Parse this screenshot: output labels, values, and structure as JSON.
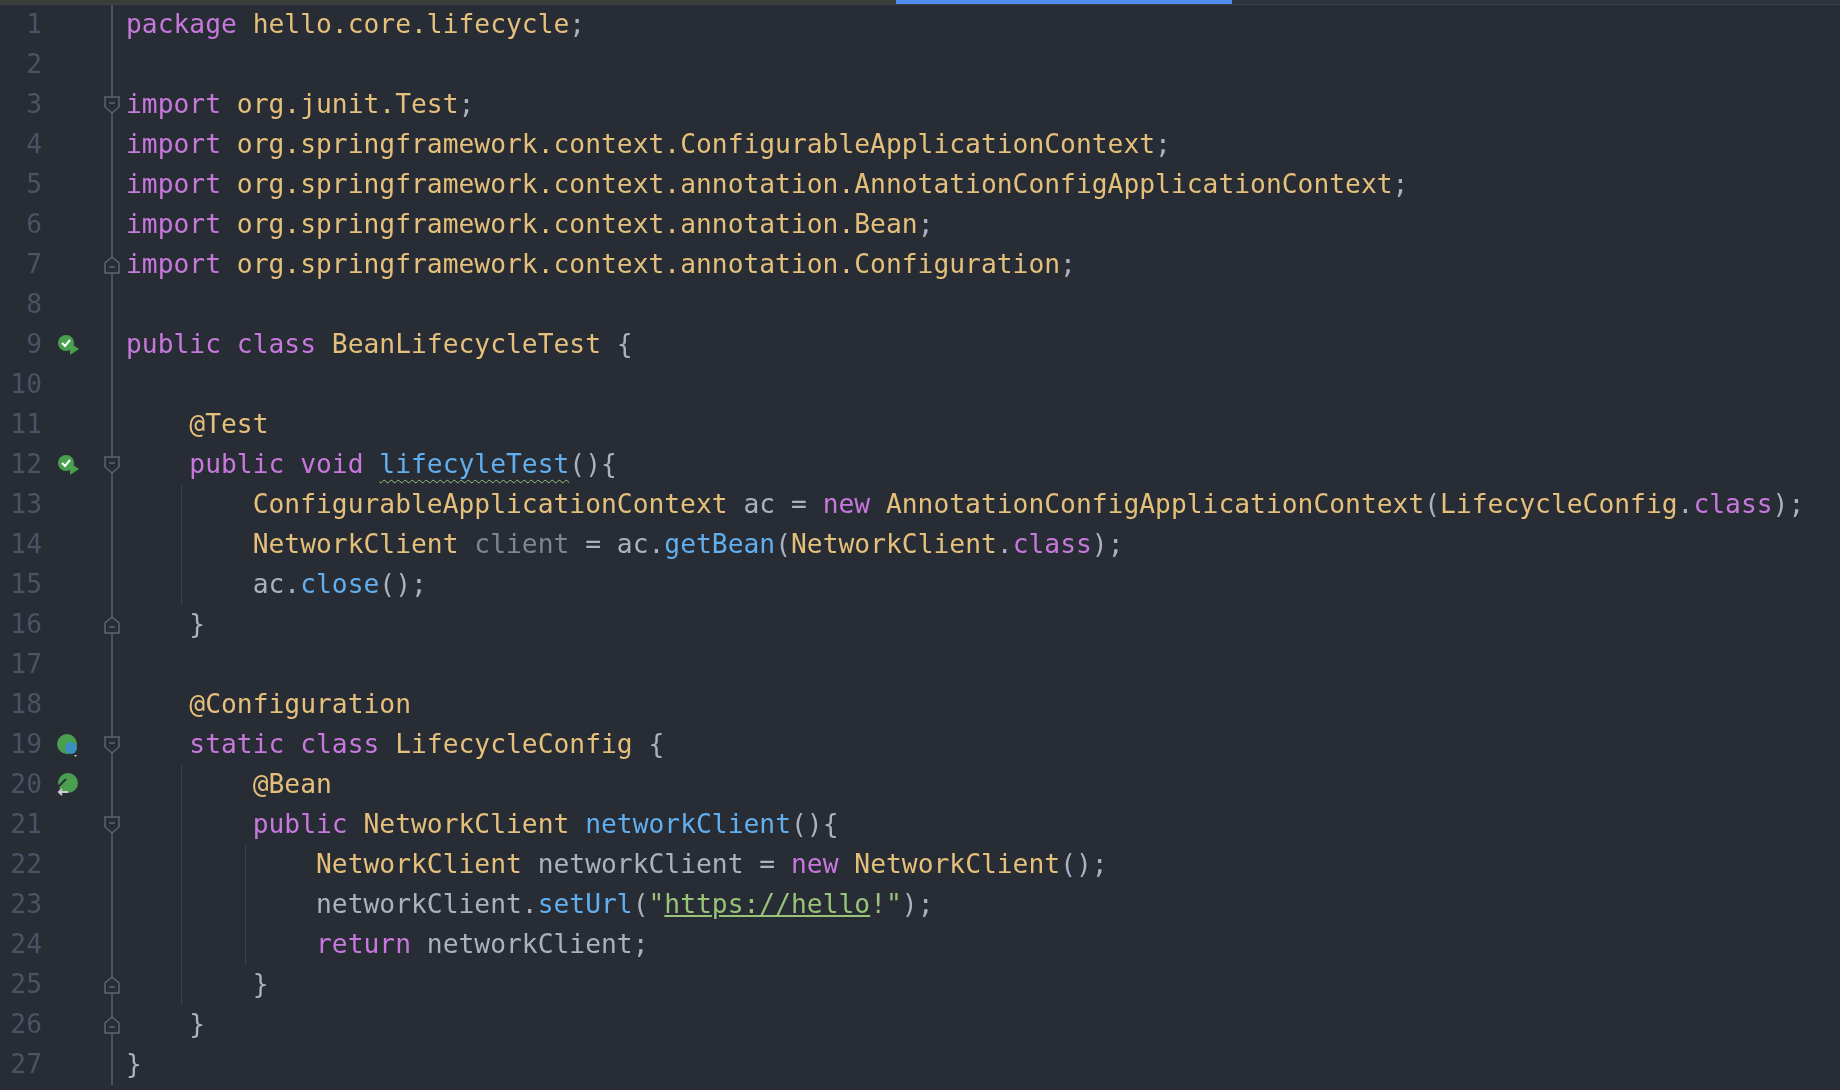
{
  "editor": {
    "lines": [
      {
        "number": "1",
        "kind": "code",
        "tokens": [
          {
            "text": "package",
            "kind": "keyword"
          },
          {
            "text": " hello.core.lifecycle",
            "kind": "type"
          },
          {
            "text": ";",
            "kind": "plain"
          }
        ]
      },
      {
        "number": "2",
        "kind": "code"
      },
      {
        "number": "3",
        "kind": "code",
        "collapsible": true,
        "tokens": [
          {
            "text": "import",
            "kind": "keyword"
          },
          {
            "text": " org.junit.Test",
            "kind": "type"
          },
          {
            "text": ";",
            "kind": "plain"
          }
        ]
      },
      {
        "number": "4",
        "kind": "code",
        "tokens": [
          {
            "text": "import",
            "kind": "keyword"
          },
          {
            "text": " org.springframework.context.ConfigurableApplicationContext",
            "kind": "type"
          },
          {
            "text": ";",
            "kind": "plain"
          }
        ]
      },
      {
        "number": "5",
        "kind": "code",
        "tokens": [
          {
            "text": "import",
            "kind": "keyword"
          },
          {
            "text": " org.springframework.context.annotation.AnnotationConfigApplicationContext",
            "kind": "type"
          },
          {
            "text": ";",
            "kind": "plain"
          }
        ]
      },
      {
        "number": "6",
        "kind": "code",
        "tokens": [
          {
            "text": "import",
            "kind": "keyword"
          },
          {
            "text": " org.springframework.context.annotation.Bean",
            "kind": "type"
          },
          {
            "text": ";",
            "kind": "plain"
          }
        ]
      },
      {
        "number": "7",
        "kind": "code",
        "block_end": true,
        "tokens": [
          {
            "text": "import",
            "kind": "keyword"
          },
          {
            "text": " org.springframework.context.annotation.Configuration",
            "kind": "type"
          },
          {
            "text": ";",
            "kind": "plain"
          }
        ]
      },
      {
        "number": "8",
        "kind": "code"
      },
      {
        "number": "9",
        "kind": "test-class",
        "tokens": [
          {
            "text": "public class",
            "kind": "keyword"
          },
          {
            "text": " BeanLifecycleTest",
            "kind": "type"
          },
          {
            "text": " {",
            "kind": "plain"
          }
        ],
        "children": [
          {
            "number": "10",
            "kind": "code"
          },
          {
            "number": "11",
            "kind": "code",
            "tokens": [
              {
                "text": "@Test",
                "kind": "type"
              }
            ]
          },
          {
            "number": "12",
            "kind": "test-method",
            "collapsible": true,
            "tokens": [
              {
                "text": "public void ",
                "kind": "keyword"
              },
              {
                "text": "lifecyleTest",
                "kind": "method",
                "warning": true
              },
              {
                "text": "(){",
                "kind": "plain"
              }
            ],
            "children": [
              {
                "number": "13",
                "kind": "code",
                "tokens": [
                  {
                    "text": "ConfigurableApplicationContext",
                    "kind": "type"
                  },
                  {
                    "text": " ac = ",
                    "kind": "plain"
                  },
                  {
                    "text": "new",
                    "kind": "keyword"
                  },
                  {
                    "text": " AnnotationConfigApplicationContext",
                    "kind": "type"
                  },
                  {
                    "text": "(",
                    "kind": "plain"
                  },
                  {
                    "text": "LifecycleConfig",
                    "kind": "type"
                  },
                  {
                    "text": ".",
                    "kind": "plain"
                  },
                  {
                    "text": "class",
                    "kind": "keyword"
                  },
                  {
                    "text": ");",
                    "kind": "plain"
                  }
                ]
              },
              {
                "number": "14",
                "kind": "code",
                "tokens": [
                  {
                    "text": "NetworkClient",
                    "kind": "type"
                  },
                  {
                    "text": " client",
                    "kind": "unused"
                  },
                  {
                    "text": " = ac.",
                    "kind": "plain"
                  },
                  {
                    "text": "getBean",
                    "kind": "method"
                  },
                  {
                    "text": "(",
                    "kind": "plain"
                  },
                  {
                    "text": "NetworkClient",
                    "kind": "type"
                  },
                  {
                    "text": ".",
                    "kind": "plain"
                  },
                  {
                    "text": "class",
                    "kind": "keyword"
                  },
                  {
                    "text": ");",
                    "kind": "plain"
                  }
                ]
              },
              {
                "number": "15",
                "kind": "code",
                "tokens": [
                  {
                    "text": "ac.",
                    "kind": "plain"
                  },
                  {
                    "text": "close",
                    "kind": "method"
                  },
                  {
                    "text": "();",
                    "kind": "plain"
                  }
                ]
              }
            ]
          },
          {
            "number": "16",
            "kind": "code",
            "block_end": true,
            "tokens": [
              {
                "text": "}",
                "kind": "plain"
              }
            ]
          },
          {
            "number": "17",
            "kind": "code"
          },
          {
            "number": "18",
            "kind": "code",
            "tokens": [
              {
                "text": "@Configuration",
                "kind": "type"
              }
            ]
          },
          {
            "number": "19",
            "kind": "bean-config",
            "collapsible": true,
            "tokens": [
              {
                "text": "static class",
                "kind": "keyword"
              },
              {
                "text": " LifecycleConfig",
                "kind": "type"
              },
              {
                "text": " {",
                "kind": "plain"
              }
            ],
            "children": [
              {
                "number": "20",
                "kind": "bean",
                "tokens": [
                  {
                    "text": "@Bean",
                    "kind": "type"
                  }
                ]
              },
              {
                "number": "21",
                "kind": "code",
                "collapsible": true,
                "tokens": [
                  {
                    "text": "public",
                    "kind": "keyword"
                  },
                  {
                    "text": " NetworkClient ",
                    "kind": "type"
                  },
                  {
                    "text": "networkClient",
                    "kind": "method"
                  },
                  {
                    "text": "(){",
                    "kind": "plain"
                  }
                ],
                "children": [
                  {
                    "number": "22",
                    "kind": "code",
                    "tokens": [
                      {
                        "text": "NetworkClient",
                        "kind": "type"
                      },
                      {
                        "text": " networkClient = ",
                        "kind": "plain"
                      },
                      {
                        "text": "new",
                        "kind": "keyword"
                      },
                      {
                        "text": " NetworkClient",
                        "kind": "type"
                      },
                      {
                        "text": "();",
                        "kind": "plain"
                      }
                    ]
                  },
                  {
                    "number": "23",
                    "kind": "code",
                    "tokens": [
                      {
                        "text": "networkClient.",
                        "kind": "plain"
                      },
                      {
                        "text": "setUrl",
                        "kind": "method"
                      },
                      {
                        "text": "(",
                        "kind": "plain"
                      },
                      {
                        "text": "\"",
                        "kind": "string"
                      },
                      {
                        "text": "https://hello",
                        "kind": "link"
                      },
                      {
                        "text": "!\"",
                        "kind": "string"
                      },
                      {
                        "text": ");",
                        "kind": "plain"
                      }
                    ]
                  },
                  {
                    "number": "24",
                    "kind": "code",
                    "tokens": [
                      {
                        "text": "return",
                        "kind": "keyword"
                      },
                      {
                        "text": " networkClient;",
                        "kind": "plain"
                      }
                    ]
                  }
                ]
              },
              {
                "number": "25",
                "kind": "code",
                "block_end": true,
                "tokens": [
                  {
                    "text": "}",
                    "kind": "plain"
                  }
                ]
              }
            ]
          },
          {
            "number": "26",
            "kind": "code",
            "block_end": true,
            "tokens": [
              {
                "text": "}",
                "kind": "plain"
              }
            ]
          }
        ]
      },
      {
        "number": "27",
        "kind": "code",
        "tokens": [
          {
            "text": "}",
            "kind": "plain"
          }
        ]
      }
    ]
  }
}
